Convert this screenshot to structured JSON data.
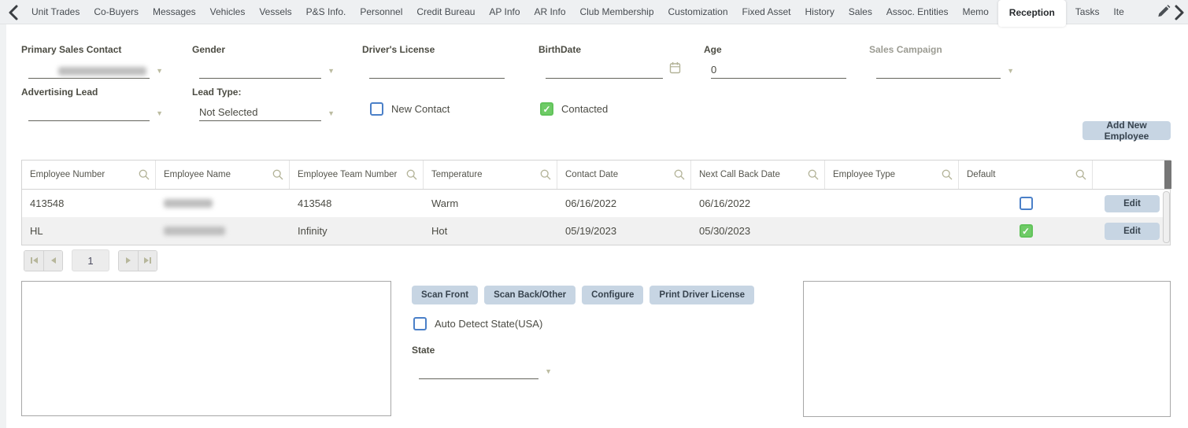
{
  "tabbar": {
    "tabs": [
      "Unit Trades",
      "Co-Buyers",
      "Messages",
      "Vehicles",
      "Vessels",
      "P&S Info.",
      "Personnel",
      "Credit Bureau",
      "AP Info",
      "AR Info",
      "Club Membership",
      "Customization",
      "Fixed Asset",
      "History",
      "Sales",
      "Assoc. Entities",
      "Memo",
      "Reception",
      "Tasks",
      "Ite"
    ],
    "active_tab": "Reception"
  },
  "form": {
    "primary_sales_contact": {
      "label": "Primary Sales Contact",
      "value_redacted": true
    },
    "gender": {
      "label": "Gender",
      "value": ""
    },
    "drivers_license": {
      "label": "Driver's License",
      "value": ""
    },
    "birthdate": {
      "label": "BirthDate",
      "value": ""
    },
    "age": {
      "label": "Age",
      "value": "0"
    },
    "sales_campaign": {
      "label": "Sales Campaign",
      "value": ""
    },
    "advertising_lead": {
      "label": "Advertising Lead",
      "value": ""
    },
    "lead_type": {
      "label": "Lead Type:",
      "value": "Not Selected"
    },
    "new_contact": {
      "label": "New Contact",
      "checked": false
    },
    "contacted": {
      "label": "Contacted",
      "checked": true
    }
  },
  "buttons": {
    "add_new_employee": "Add New Employee",
    "scan_front": "Scan Front",
    "scan_back_other": "Scan Back/Other",
    "configure": "Configure",
    "print_driver_license": "Print Driver License",
    "edit": "Edit"
  },
  "table": {
    "columns": [
      "Employee Number",
      "Employee Name",
      "Employee Team Number",
      "Temperature",
      "Contact Date",
      "Next Call Back Date",
      "Employee Type",
      "Default"
    ],
    "rows": [
      {
        "employee_number": "413548",
        "employee_name_redacted": true,
        "employee_team_number": "413548",
        "temperature": "Warm",
        "contact_date": "06/16/2022",
        "next_call_back_date": "06/16/2022",
        "employee_type": "",
        "default_checked": false
      },
      {
        "employee_number": "HL",
        "employee_name_redacted": true,
        "employee_team_number": "Infinity",
        "temperature": "Hot",
        "contact_date": "05/19/2023",
        "next_call_back_date": "05/30/2023",
        "employee_type": "",
        "default_checked": true
      }
    ]
  },
  "pagination": {
    "page": "1"
  },
  "scanner": {
    "auto_detect_label": "Auto Detect State(USA)",
    "auto_detect_checked": false,
    "state_label": "State",
    "state_value": ""
  },
  "icons": {
    "dropdown": "▼",
    "check": "✓"
  },
  "colors": {
    "tabbar_bg": "#eef0f2",
    "button_bg": "#c7d5e3",
    "checkbox_blue": "#4b80c8",
    "checked_green": "#6fcb67",
    "icon_olive": "#b3b398",
    "scrollbar_dark": "#767676",
    "row_alt_bg": "#f1f1f1"
  }
}
